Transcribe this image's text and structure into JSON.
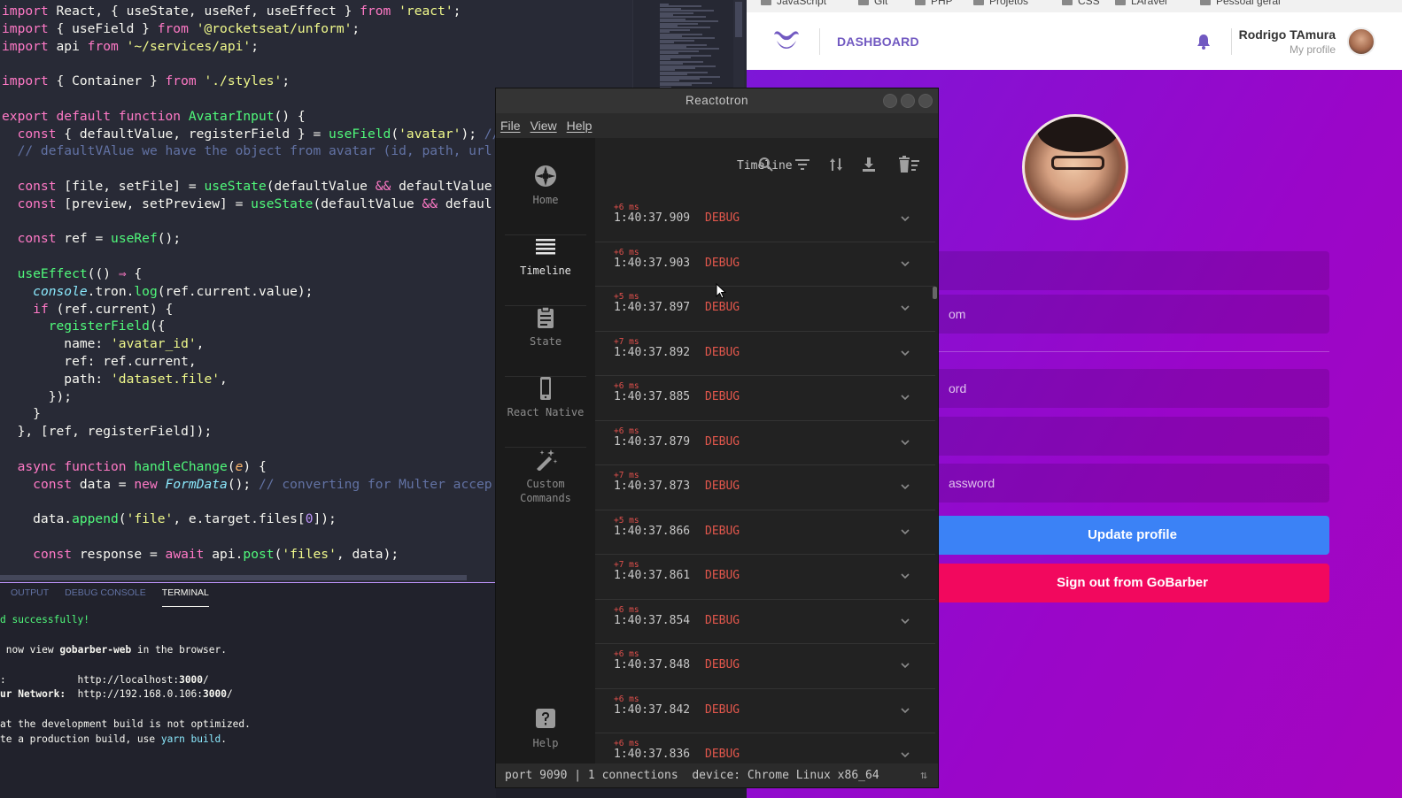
{
  "editor": {
    "code_lines": [
      [
        {
          "t": "import",
          "c": "kw"
        },
        {
          "t": " React, { useState, useRef, useEffect } "
        },
        {
          "t": "from",
          "c": "kw"
        },
        {
          "t": " "
        },
        {
          "t": "'react'",
          "c": "st"
        },
        {
          "t": ";"
        }
      ],
      [
        {
          "t": "import",
          "c": "kw"
        },
        {
          "t": " { useField } "
        },
        {
          "t": "from",
          "c": "kw"
        },
        {
          "t": " "
        },
        {
          "t": "'@rocketseat/unform'",
          "c": "st"
        },
        {
          "t": ";"
        }
      ],
      [
        {
          "t": "import",
          "c": "kw"
        },
        {
          "t": " api "
        },
        {
          "t": "from",
          "c": "kw"
        },
        {
          "t": " "
        },
        {
          "t": "'~/services/api'",
          "c": "st"
        },
        {
          "t": ";"
        }
      ],
      [],
      [
        {
          "t": "import",
          "c": "kw"
        },
        {
          "t": " { Container } "
        },
        {
          "t": "from",
          "c": "kw"
        },
        {
          "t": " "
        },
        {
          "t": "'./styles'",
          "c": "st"
        },
        {
          "t": ";"
        }
      ],
      [],
      [
        {
          "t": "export default function",
          "c": "kw"
        },
        {
          "t": " "
        },
        {
          "t": "AvatarInput",
          "c": "fn"
        },
        {
          "t": "() {"
        }
      ],
      [
        {
          "t": "  "
        },
        {
          "t": "const",
          "c": "kw"
        },
        {
          "t": " { defaultValue, registerField } = "
        },
        {
          "t": "useField",
          "c": "fn"
        },
        {
          "t": "("
        },
        {
          "t": "'avatar'",
          "c": "st"
        },
        {
          "t": "); "
        },
        {
          "t": "//",
          "c": "cm"
        }
      ],
      [
        {
          "t": "  "
        },
        {
          "t": "// defaultVAlue we have the object from avatar (id, path, url",
          "c": "cm"
        }
      ],
      [],
      [
        {
          "t": "  "
        },
        {
          "t": "const",
          "c": "kw"
        },
        {
          "t": " [file, setFile] = "
        },
        {
          "t": "useState",
          "c": "fn"
        },
        {
          "t": "(defaultValue "
        },
        {
          "t": "&&",
          "c": "kw"
        },
        {
          "t": " defaultValue"
        }
      ],
      [
        {
          "t": "  "
        },
        {
          "t": "const",
          "c": "kw"
        },
        {
          "t": " [preview, setPreview] = "
        },
        {
          "t": "useState",
          "c": "fn"
        },
        {
          "t": "(defaultValue "
        },
        {
          "t": "&&",
          "c": "kw"
        },
        {
          "t": " defaul"
        }
      ],
      [],
      [
        {
          "t": "  "
        },
        {
          "t": "const",
          "c": "kw"
        },
        {
          "t": " ref = "
        },
        {
          "t": "useRef",
          "c": "fn"
        },
        {
          "t": "();"
        }
      ],
      [],
      [
        {
          "t": "  "
        },
        {
          "t": "useEffect",
          "c": "fn"
        },
        {
          "t": "(() "
        },
        {
          "t": "⇒",
          "c": "kw"
        },
        {
          "t": " {"
        }
      ],
      [
        {
          "t": "    "
        },
        {
          "t": "console",
          "c": "it"
        },
        {
          "t": ".tron."
        },
        {
          "t": "log",
          "c": "fn"
        },
        {
          "t": "(ref.current.value);"
        }
      ],
      [
        {
          "t": "    "
        },
        {
          "t": "if",
          "c": "kw"
        },
        {
          "t": " (ref.current) {"
        }
      ],
      [
        {
          "t": "      "
        },
        {
          "t": "registerField",
          "c": "fn"
        },
        {
          "t": "({"
        }
      ],
      [
        {
          "t": "        name: "
        },
        {
          "t": "'avatar_id'",
          "c": "st"
        },
        {
          "t": ","
        }
      ],
      [
        {
          "t": "        ref: ref.current,"
        }
      ],
      [
        {
          "t": "        path: "
        },
        {
          "t": "'dataset.file'",
          "c": "st"
        },
        {
          "t": ","
        }
      ],
      [
        {
          "t": "      });"
        }
      ],
      [
        {
          "t": "    }"
        }
      ],
      [
        {
          "t": "  }, [ref, registerField]);"
        }
      ],
      [],
      [
        {
          "t": "  "
        },
        {
          "t": "async function",
          "c": "kw"
        },
        {
          "t": " "
        },
        {
          "t": "handleChange",
          "c": "fn"
        },
        {
          "t": "("
        },
        {
          "t": "e",
          "c": "or"
        },
        {
          "t": ") {"
        }
      ],
      [
        {
          "t": "    "
        },
        {
          "t": "const",
          "c": "kw"
        },
        {
          "t": " data = "
        },
        {
          "t": "new",
          "c": "kw"
        },
        {
          "t": " "
        },
        {
          "t": "FormData",
          "c": "it"
        },
        {
          "t": "(); "
        },
        {
          "t": "// converting for Multer accep",
          "c": "cm"
        }
      ],
      [],
      [
        {
          "t": "    data."
        },
        {
          "t": "append",
          "c": "fn"
        },
        {
          "t": "("
        },
        {
          "t": "'file'",
          "c": "st"
        },
        {
          "t": ", e.target.files["
        },
        {
          "t": "0",
          "c": "pu"
        },
        {
          "t": "]);"
        }
      ],
      [],
      [
        {
          "t": "    "
        },
        {
          "t": "const",
          "c": "kw"
        },
        {
          "t": " response = "
        },
        {
          "t": "await",
          "c": "kw"
        },
        {
          "t": " api."
        },
        {
          "t": "post",
          "c": "fn"
        },
        {
          "t": "("
        },
        {
          "t": "'files'",
          "c": "st"
        },
        {
          "t": ", data);"
        }
      ]
    ]
  },
  "panel": {
    "tabs": [
      "OUTPUT",
      "DEBUG CONSOLE",
      "TERMINAL"
    ],
    "active_tab": "TERMINAL",
    "terminal_lines": [
      [
        {
          "t": "d successfully!",
          "c": "ok"
        }
      ],
      [],
      [
        {
          "t": " now view "
        },
        {
          "t": "gobarber-web",
          "c": "b"
        },
        {
          "t": " in the browser."
        }
      ],
      [],
      [
        {
          "t": ":            http://localhost:"
        },
        {
          "t": "3000",
          "c": "b"
        },
        {
          "t": "/"
        }
      ],
      [
        {
          "t": "ur Network:",
          "c": "b"
        },
        {
          "t": "  http://192.168.0.106:"
        },
        {
          "t": "3000",
          "c": "b"
        },
        {
          "t": "/"
        }
      ],
      [],
      [
        {
          "t": "at the development build is not optimized."
        }
      ],
      [
        {
          "t": "te a production build, use "
        },
        {
          "t": "yarn build",
          "c": "cy"
        },
        {
          "t": "."
        }
      ]
    ]
  },
  "browser": {
    "bookmarks": [
      "JavaScript",
      "Git",
      "PHP",
      "Projetos",
      "CSS",
      "LAravel",
      "Pessoal geral"
    ],
    "nav_title": "DASHBOARD",
    "user_name": "Rodrigo TAmura",
    "my_profile": "My profile",
    "fields": [
      {
        "value": ""
      },
      {
        "value": "om"
      },
      {
        "value": "ord"
      },
      {
        "value": ""
      },
      {
        "value": "assword"
      }
    ],
    "update_button": "Update profile",
    "signout_button": "Sign out from GoBarber",
    "colors": {
      "accent": "#7159c1",
      "update": "#3b82f6",
      "signout": "#f2085e"
    }
  },
  "reactotron": {
    "window_title": "Reactotron",
    "menu": [
      "File",
      "View",
      "Help"
    ],
    "nav": [
      {
        "label": "Home",
        "icon": "home-icon"
      },
      {
        "label": "Timeline",
        "icon": "timeline-icon",
        "active": true
      },
      {
        "label": "State",
        "icon": "clipboard-icon"
      },
      {
        "label": "React Native",
        "icon": "phone-icon"
      },
      {
        "label": "Custom Commands",
        "icon": "magic-wand-icon"
      },
      {
        "label": "Help",
        "icon": "help-icon"
      }
    ],
    "header_title": "Timeline",
    "rows": [
      {
        "delta": "+6 ms",
        "time": "1:40:37.909",
        "level": "DEBUG"
      },
      {
        "delta": "+6 ms",
        "time": "1:40:37.903",
        "level": "DEBUG"
      },
      {
        "delta": "+5 ms",
        "time": "1:40:37.897",
        "level": "DEBUG"
      },
      {
        "delta": "+7 ms",
        "time": "1:40:37.892",
        "level": "DEBUG"
      },
      {
        "delta": "+6 ms",
        "time": "1:40:37.885",
        "level": "DEBUG"
      },
      {
        "delta": "+6 ms",
        "time": "1:40:37.879",
        "level": "DEBUG"
      },
      {
        "delta": "+7 ms",
        "time": "1:40:37.873",
        "level": "DEBUG"
      },
      {
        "delta": "+5 ms",
        "time": "1:40:37.866",
        "level": "DEBUG"
      },
      {
        "delta": "+7 ms",
        "time": "1:40:37.861",
        "level": "DEBUG"
      },
      {
        "delta": "+6 ms",
        "time": "1:40:37.854",
        "level": "DEBUG"
      },
      {
        "delta": "+6 ms",
        "time": "1:40:37.848",
        "level": "DEBUG"
      },
      {
        "delta": "+6 ms",
        "time": "1:40:37.842",
        "level": "DEBUG"
      },
      {
        "delta": "+6 ms",
        "time": "1:40:37.836",
        "level": "DEBUG"
      }
    ],
    "status": "port 9090 | 1 connections  device: Chrome Linux x86_64",
    "status_icon": "swap-icon"
  }
}
